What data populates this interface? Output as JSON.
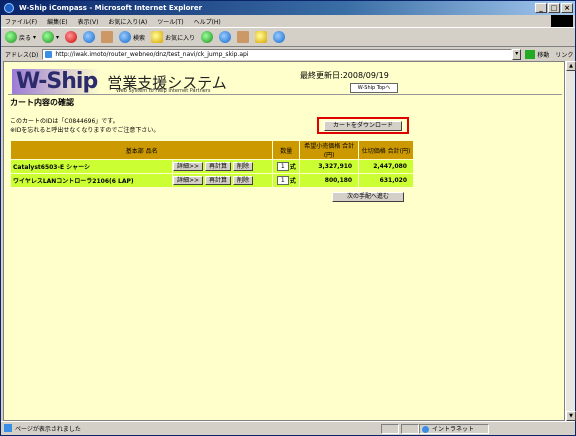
{
  "window": {
    "title": "W-Ship iCompass - Microsoft Internet Explorer"
  },
  "menu": [
    "ファイル(F)",
    "編集(E)",
    "表示(V)",
    "お気に入り(A)",
    "ツール(T)",
    "ヘルプ(H)"
  ],
  "toolbar": {
    "back": "戻る",
    "search": "検索",
    "favorites": "お気に入り"
  },
  "address": {
    "label": "アドレス(D)",
    "url": "http://iwak.imoto/router_webneo/dnz/test_navi/ck_jump_skip.api",
    "go": "移動",
    "links": "リンク"
  },
  "page": {
    "logo": "W-Ship",
    "logo_jp": "営業支援システム",
    "logo_sub": "Web System to Help Internet Partners",
    "updated": "最終更新日:2008/09/19",
    "top_link": "W-Ship Topへ",
    "title": "カート内容の確認",
    "note1": "このカートのIDは「C0844696」です。",
    "note2": "※IDを忘れると呼出せなくなりますのでご注意下さい。",
    "download_button": "カートをダウンロード",
    "next_button": "次の手配へ進む"
  },
  "table": {
    "headers": {
      "part": "基本部 品名",
      "qty": "数量",
      "list": "希望小売価格 合計(円)",
      "net": "仕切価格 合計(円)"
    },
    "rows": [
      {
        "name": "Catalyst6503-E シャーシ",
        "detail": "詳細>>",
        "recalc": "再計算",
        "delete": "削除",
        "qty": "1",
        "unit": "式",
        "list": "3,327,910",
        "net": "2,447,080"
      },
      {
        "name": "ワイヤレスLANコントローラ2106(6 LAP)",
        "detail": "詳細>>",
        "recalc": "再計算",
        "delete": "削除",
        "qty": "1",
        "unit": "式",
        "list": "800,180",
        "net": "631,020"
      }
    ]
  },
  "status": {
    "message": "ページが表示されました",
    "zone": "イントラネット"
  }
}
